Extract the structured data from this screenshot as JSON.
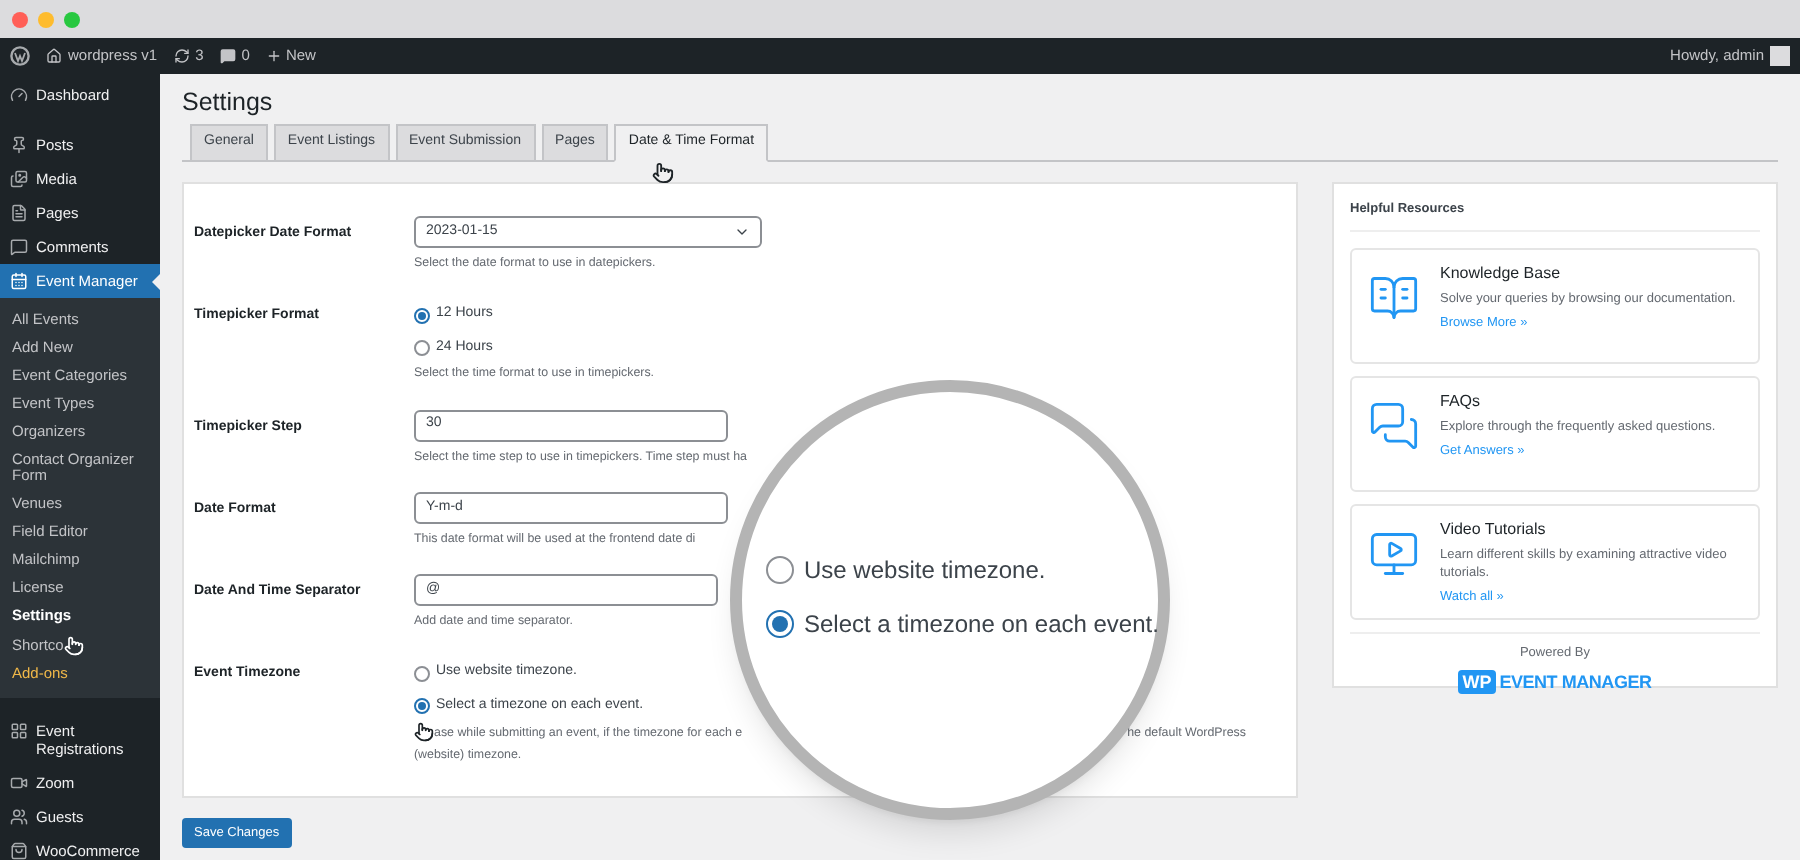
{
  "window_controls": [
    {
      "color": "#ff5f57"
    },
    {
      "color": "#febc2e"
    },
    {
      "color": "#28c840"
    }
  ],
  "admin_bar": {
    "site": "wordpress v1",
    "updates": "3",
    "comments": "0",
    "new": "New",
    "greeting": "Howdy, admin"
  },
  "sidebar": {
    "items": [
      {
        "label": "Dashboard",
        "selected": false
      },
      {
        "label": "Posts",
        "selected": false
      },
      {
        "label": "Media",
        "selected": false
      },
      {
        "label": "Pages",
        "selected": false
      },
      {
        "label": "Comments",
        "selected": false
      },
      {
        "label": "Event Manager",
        "selected": true,
        "children": [
          {
            "label": "All Events",
            "selected": false,
            "kind": "normal"
          },
          {
            "label": "Add New",
            "selected": false,
            "kind": "normal"
          },
          {
            "label": "Event Categories",
            "selected": false,
            "kind": "normal"
          },
          {
            "label": "Event Types",
            "selected": false,
            "kind": "normal"
          },
          {
            "label": "Organizers",
            "selected": false,
            "kind": "normal"
          },
          {
            "label": "Contact Organizer Form",
            "selected": false,
            "kind": "normal"
          },
          {
            "label": "Venues",
            "selected": false,
            "kind": "normal"
          },
          {
            "label": "Field Editor",
            "selected": false,
            "kind": "normal"
          },
          {
            "label": "Mailchimp",
            "selected": false,
            "kind": "normal"
          },
          {
            "label": "License",
            "selected": false,
            "kind": "normal"
          },
          {
            "label": "Settings",
            "selected": true,
            "kind": "normal"
          },
          {
            "label": "Shortco",
            "selected": false,
            "kind": "cursor"
          },
          {
            "label": "Add-ons",
            "selected": false,
            "kind": "addon"
          }
        ]
      },
      {
        "label": "Event Registrations",
        "selected": false
      },
      {
        "label": "Zoom",
        "selected": false
      },
      {
        "label": "Guests",
        "selected": false
      },
      {
        "label": "WooCommerce",
        "selected": false
      }
    ]
  },
  "page_title": "Settings",
  "tabs": [
    {
      "label": "General",
      "selected": false
    },
    {
      "label": "Event Listings",
      "selected": false
    },
    {
      "label": "Event Submission",
      "selected": false
    },
    {
      "label": "Pages",
      "selected": false
    },
    {
      "label": "Date & Time Format",
      "selected": true
    }
  ],
  "rows": [
    {
      "label": "Datepicker Date Format",
      "kind": "select",
      "value": "2023-01-15",
      "description": "Select the date format to use in datepickers."
    },
    {
      "label": "Timepicker Format",
      "kind": "radio",
      "options": [
        {
          "label": "12 Hours",
          "selected": true
        },
        {
          "label": "24 Hours",
          "selected": false
        }
      ],
      "description": "Select the time format to use in timepickers."
    },
    {
      "label": "Timepicker Step",
      "kind": "input",
      "value": "30",
      "description": "Select the time step to use in timepickers. Time step must ha"
    },
    {
      "label": "Date Format",
      "kind": "input",
      "value": "Y-m-d",
      "description": "This date format will be used at the frontend date di"
    },
    {
      "label": "Date And Time Separator",
      "kind": "input",
      "value": "@",
      "description": "Add date and time separator."
    },
    {
      "label": "Event Timezone",
      "kind": "radio",
      "options": [
        {
          "label": "Use website timezone.",
          "selected": false
        },
        {
          "label": "Select a timezone on each event.",
          "selected": true
        }
      ],
      "description_parts": [
        "ase while submitting an event, if the timezone for each e",
        "he default WordPress",
        "(website) timezone."
      ]
    }
  ],
  "save_button": "Save Changes",
  "resources": {
    "title": "Helpful Resources",
    "cards": [
      {
        "title": "Knowledge Base",
        "description": "Solve your queries by browsing our documentation.",
        "link": "Browse More »"
      },
      {
        "title": "FAQs",
        "description": "Explore through the frequently asked questions.",
        "link": "Get Answers »"
      },
      {
        "title": "Video Tutorials",
        "description": "Learn different skills by examining attractive video tutorials.",
        "link": "Watch all »"
      }
    ],
    "powered_by": "Powered By",
    "logo_badge": "WP",
    "logo_text": "EVENT MANAGER"
  },
  "magnifier": {
    "options": [
      {
        "label": "Use website timezone.",
        "selected": false
      },
      {
        "label": "Select a timezone on each event.",
        "selected": true
      }
    ]
  }
}
